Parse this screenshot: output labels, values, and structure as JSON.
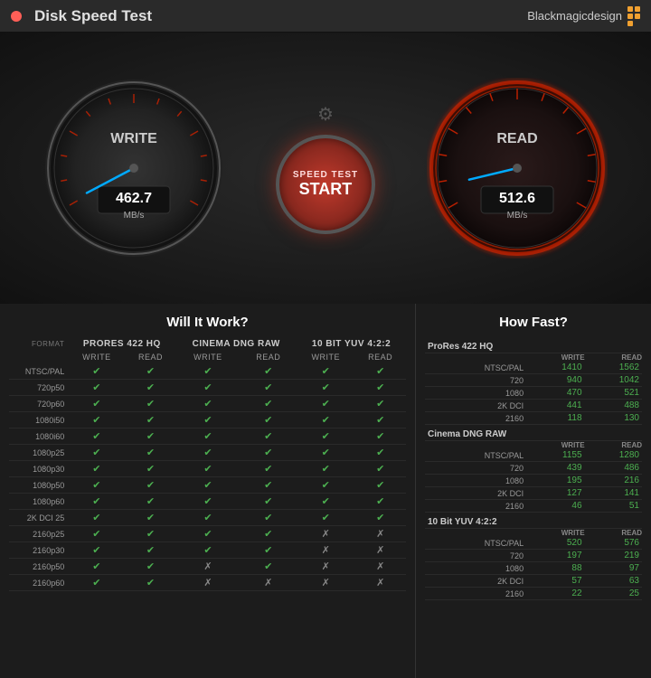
{
  "titleBar": {
    "title": "Disk Speed Test",
    "brand": "Blackmagicdesign",
    "closeBtn": "×"
  },
  "gauges": {
    "write": {
      "label": "WRITE",
      "value": "462.7",
      "unit": "MB/s",
      "needleAngle": -60
    },
    "read": {
      "label": "READ",
      "value": "512.6",
      "unit": "MB/s",
      "needleAngle": -55
    },
    "centerButton": {
      "line1": "SPEED TEST",
      "line2": "START"
    }
  },
  "willItWork": {
    "title": "Will It Work?",
    "formatHeader": "FORMAT",
    "codecs": [
      "ProRes 422 HQ",
      "Cinema DNG RAW",
      "10 Bit YUV 4:2:2"
    ],
    "writeReadHeader": [
      "WRITE",
      "READ"
    ],
    "rows": [
      {
        "name": "NTSC/PAL",
        "values": [
          true,
          true,
          true,
          true,
          true,
          true
        ]
      },
      {
        "name": "720p50",
        "values": [
          true,
          true,
          true,
          true,
          true,
          true
        ]
      },
      {
        "name": "720p60",
        "values": [
          true,
          true,
          true,
          true,
          true,
          true
        ]
      },
      {
        "name": "1080i50",
        "values": [
          true,
          true,
          true,
          true,
          true,
          true
        ]
      },
      {
        "name": "1080i60",
        "values": [
          true,
          true,
          true,
          true,
          true,
          true
        ]
      },
      {
        "name": "1080p25",
        "values": [
          true,
          true,
          true,
          true,
          true,
          true
        ]
      },
      {
        "name": "1080p30",
        "values": [
          true,
          true,
          true,
          true,
          true,
          true
        ]
      },
      {
        "name": "1080p50",
        "values": [
          true,
          true,
          true,
          true,
          true,
          true
        ]
      },
      {
        "name": "1080p60",
        "values": [
          true,
          true,
          true,
          true,
          true,
          true
        ]
      },
      {
        "name": "2K DCI 25",
        "values": [
          true,
          true,
          true,
          true,
          true,
          true
        ]
      },
      {
        "name": "2160p25",
        "values": [
          true,
          true,
          true,
          true,
          false,
          false
        ]
      },
      {
        "name": "2160p30",
        "values": [
          true,
          true,
          true,
          true,
          false,
          false
        ]
      },
      {
        "name": "2160p50",
        "values": [
          true,
          true,
          false,
          true,
          false,
          false
        ]
      },
      {
        "name": "2160p60",
        "values": [
          true,
          true,
          false,
          false,
          false,
          false
        ]
      }
    ]
  },
  "howFast": {
    "title": "How Fast?",
    "sections": [
      {
        "codec": "ProRes 422 HQ",
        "rows": [
          {
            "name": "NTSC/PAL",
            "write": 1410,
            "read": 1562
          },
          {
            "name": "720",
            "write": 940,
            "read": 1042
          },
          {
            "name": "1080",
            "write": 470,
            "read": 521
          },
          {
            "name": "2K DCI",
            "write": 441,
            "read": 488
          },
          {
            "name": "2160",
            "write": 118,
            "read": 130
          }
        ]
      },
      {
        "codec": "Cinema DNG RAW",
        "rows": [
          {
            "name": "NTSC/PAL",
            "write": 1155,
            "read": 1280
          },
          {
            "name": "720",
            "write": 439,
            "read": 486
          },
          {
            "name": "1080",
            "write": 195,
            "read": 216
          },
          {
            "name": "2K DCI",
            "write": 127,
            "read": 141
          },
          {
            "name": "2160",
            "write": 46,
            "read": 51
          }
        ]
      },
      {
        "codec": "10 Bit YUV 4:2:2",
        "rows": [
          {
            "name": "NTSC/PAL",
            "write": 520,
            "read": 576
          },
          {
            "name": "720",
            "write": 197,
            "read": 219
          },
          {
            "name": "1080",
            "write": 88,
            "read": 97
          },
          {
            "name": "2K DCI",
            "write": 57,
            "read": 63
          },
          {
            "name": "2160",
            "write": 22,
            "read": 25
          }
        ]
      }
    ]
  }
}
